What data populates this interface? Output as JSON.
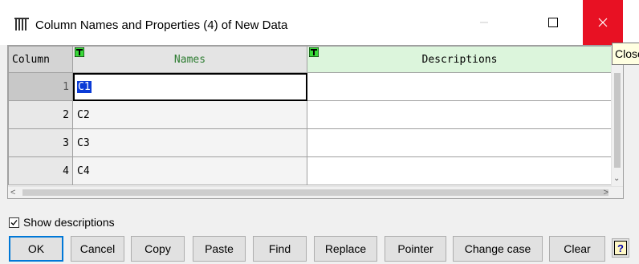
{
  "window": {
    "title": "Column Names and Properties (4) of New Data",
    "minimize_icon": "minimize-icon",
    "maximize_icon": "maximize-icon",
    "close_icon": "close-icon",
    "close_color": "#e81123"
  },
  "tooltip": {
    "text": "Close"
  },
  "grid": {
    "headers": {
      "column": "Column",
      "names": "Names",
      "descriptions": "Descriptions"
    },
    "header_icon": "text-type-icon",
    "rows": [
      {
        "num": "1",
        "name": "C1",
        "description": ""
      },
      {
        "num": "2",
        "name": "C2",
        "description": ""
      },
      {
        "num": "3",
        "name": "C3",
        "description": ""
      },
      {
        "num": "4",
        "name": "C4",
        "description": ""
      }
    ]
  },
  "show_descriptions": {
    "label": "Show descriptions",
    "checked": true
  },
  "buttons": {
    "ok": "OK",
    "cancel": "Cancel",
    "copy": "Copy",
    "paste": "Paste",
    "find": "Find",
    "replace": "Replace",
    "pointer": "Pointer",
    "change_case": "Change case",
    "clear": "Clear",
    "help": "?"
  },
  "colors": {
    "accent": "#0078d7",
    "selection": "#0a3bd6",
    "names_header_text": "#2e7d32",
    "descriptions_header_bg": "#dcf5dc"
  }
}
